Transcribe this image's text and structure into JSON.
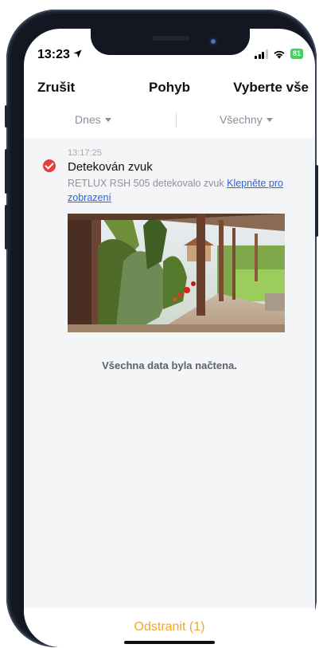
{
  "status_bar": {
    "time": "13:23",
    "battery": "81"
  },
  "header": {
    "cancel_label": "Zrušit",
    "title": "Pohyb",
    "select_all_label": "Vyberte vše"
  },
  "filters": {
    "date": "Dnes",
    "type": "Všechny"
  },
  "events": [
    {
      "time": "13:17:25",
      "title": "Detekován zvuk",
      "description": "RETLUX RSH 505 detekovalo zvuk",
      "link": "Klepněte pro zobrazení",
      "selected": true
    }
  ],
  "list_footer": "Všechna data byla načtena.",
  "bottom_bar": {
    "delete_label": "Odstranit (1)"
  },
  "colors": {
    "accent": "#f5a623",
    "check": "#e93d3d",
    "link": "#2a63e0",
    "battery": "#3fd35e"
  }
}
